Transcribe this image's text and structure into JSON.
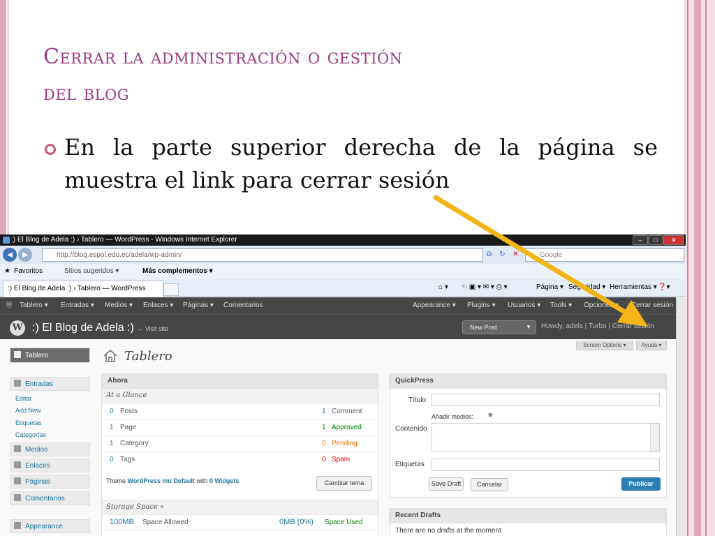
{
  "slide": {
    "title_line1": "Cerrar la administración o gestión",
    "title_line2": "del blog",
    "bullet_text": "En la parte superior derecha de la página se muestra el link para cerrar sesión"
  },
  "browser": {
    "window_title": ":) El Blog de Adela :) › Tablero — WordPress - Windows Internet Explorer",
    "address": "http://blog.espol.edu.ec/adela/wp-admin/",
    "search_placeholder": "Google",
    "favorites": "Favoritos",
    "sitios": "Sitios sugeridos ▾",
    "mas": "Más complementos ▾",
    "tab_title": ":) El Blog de Adela :) › Tablero — WordPress",
    "tools": {
      "pagina": "Página ▾",
      "seguridad": "Seguridad ▾",
      "herramientas": "Herramientas ▾"
    }
  },
  "wp": {
    "admin_menu_left": [
      "Tablero ▾",
      "Entradas ▾",
      "Medios ▾",
      "Enlaces ▾",
      "Páginas ▾",
      "Comentarios"
    ],
    "admin_menu_right": [
      "Appearance ▾",
      "Plugins ▾",
      "Usuarios ▾",
      "Tools ▾",
      "Opciones ▾"
    ],
    "cerrar_sesion_top": "Cerrar sesión",
    "blog_name": ":) El Blog de Adela :)",
    "visit_site": "← Visit site",
    "new_post": "New Post",
    "howdy": "Howdy, adela | Turbo | Cerrar sesión",
    "screen_options": "Screen Options ▾",
    "ayuda": "Ayuda ▾",
    "page_title": "Tablero",
    "sidebar": {
      "tablero": "Tablero",
      "entradas": "Entradas",
      "sub": [
        "Editar",
        "Add New",
        "Etiquetas",
        "Categorías"
      ],
      "medios": "Medios",
      "enlaces": "Enlaces",
      "paginas": "Páginas",
      "comentarios": "Comentarios",
      "appearance": "Appearance"
    },
    "ahora": {
      "title": "Ahora",
      "at_a_glance": "At a Glance",
      "rows": [
        {
          "ln": "0",
          "lt": "Posts",
          "rn": "1",
          "rt": "Comment"
        },
        {
          "ln": "1",
          "lt": "Page",
          "rn": "1",
          "rt": "Approved"
        },
        {
          "ln": "1",
          "lt": "Category",
          "rn": "0",
          "rt": "Pending"
        },
        {
          "ln": "0",
          "lt": "Tags",
          "rn": "0",
          "rt": "Spam"
        }
      ],
      "theme_prefix": "Theme",
      "theme_name": "WordPress mu Default",
      "theme_with": "with",
      "widgets": "0 Widgets",
      "cambiar_tema": "Cambiar tema",
      "storage_title": "Storage Space »",
      "space_allowed_num": "100MB",
      "space_allowed_label": "Space Allowed",
      "space_used_num": "0MB (0%)",
      "space_used_label": "Space Used"
    },
    "quickpress": {
      "title": "QuickPress",
      "titulo": "Título",
      "anadir": "Añadir medios:",
      "contenido": "Contenido",
      "etiquetas": "Etiquetas",
      "save_draft": "Save Draft",
      "cancelar": "Cancelar",
      "publicar": "Publicar"
    },
    "recent_drafts": {
      "title": "Recent Drafts",
      "empty": "There are no drafts at the moment"
    }
  },
  "colors": {
    "title": "#9c3d84",
    "arrow": "#f2b417",
    "wp_link": "#21759b"
  }
}
